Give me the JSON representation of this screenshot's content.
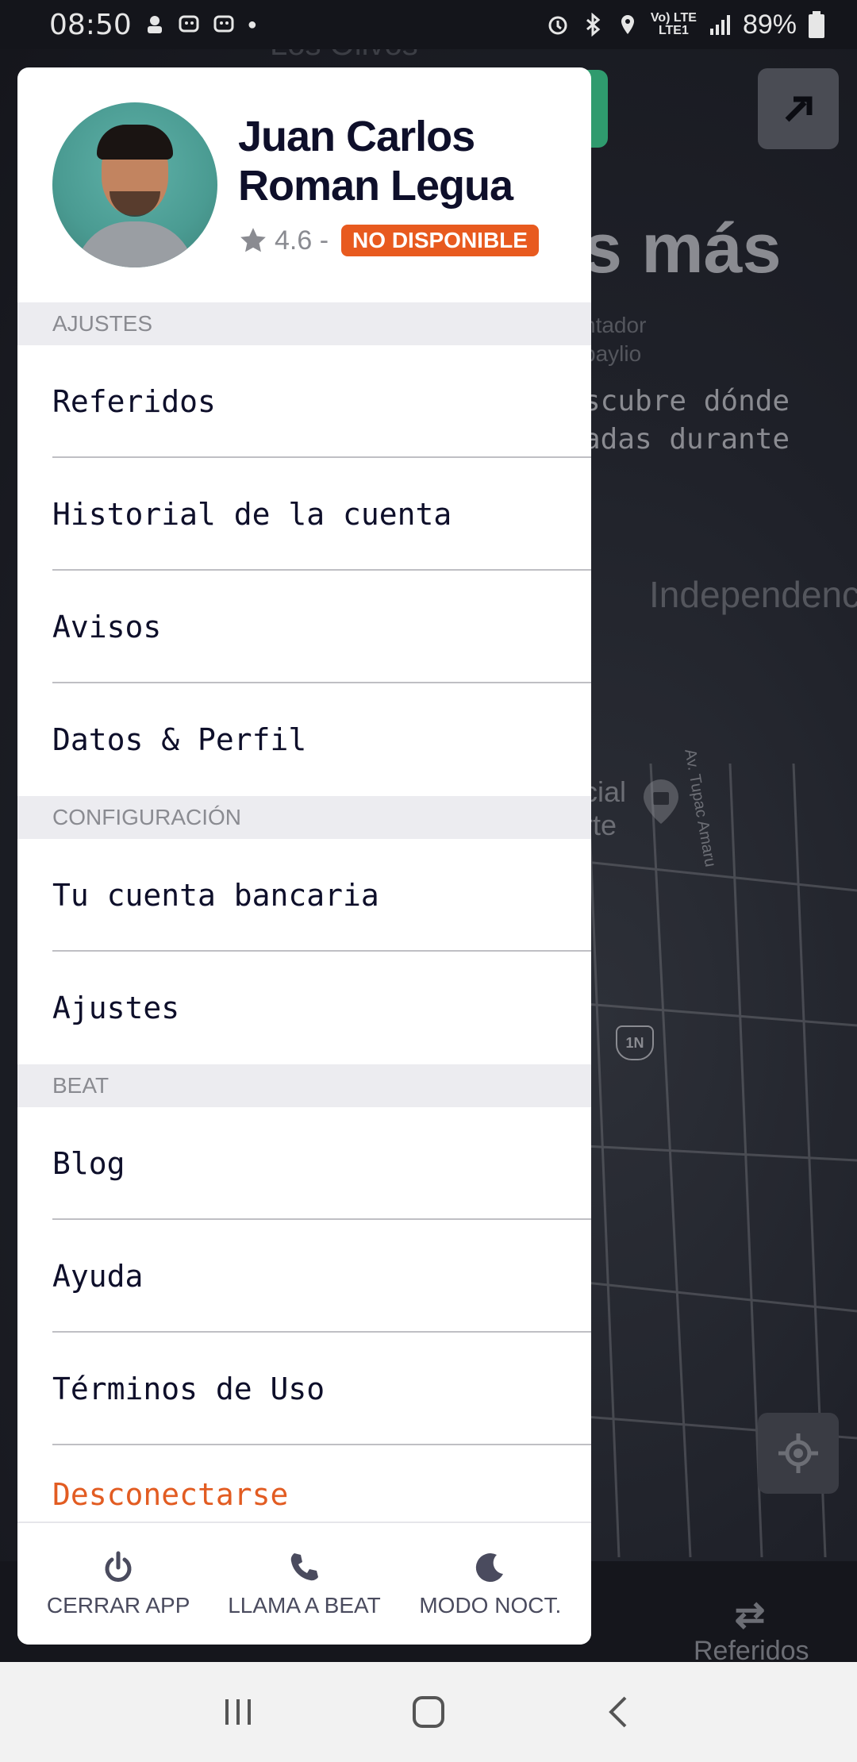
{
  "status_bar": {
    "time": "08:50",
    "network_label": "Vo) LTE\nLTE1",
    "battery": "89%"
  },
  "background": {
    "headline": "s más",
    "small_text": "ntador\nbaylio",
    "subtext": "scubre dónde\nadas durante",
    "place_independencia": "Independenc",
    "place_comercial": "cial\nrte",
    "road_label": "Av. Tupac Amaru",
    "highway": "1N",
    "top_place": "Los Olivos",
    "bottom_tab_label": "Referidos"
  },
  "profile": {
    "name_line1": "Juan Carlos",
    "name_line2": "Roman Legua",
    "rating": "4.6 -",
    "status_badge": "NO DISPONIBLE"
  },
  "sections": {
    "ajustes": "AJUSTES",
    "configuracion": "CONFIGURACIÓN",
    "beat": "BEAT"
  },
  "menu": {
    "referidos": "Referidos",
    "historial": "Historial de la cuenta",
    "avisos": "Avisos",
    "datos_perfil": "Datos & Perfil",
    "cuenta_bancaria": "Tu cuenta bancaria",
    "ajustes": "Ajustes",
    "blog": "Blog",
    "ayuda": "Ayuda",
    "terminos": "Términos de Uso",
    "desconectarse": "Desconectarse"
  },
  "drawer_actions": {
    "close_app": "CERRAR APP",
    "call_beat": "LLAMA A BEAT",
    "night_mode": "MODO NOCT."
  },
  "colors": {
    "accent_orange": "#e85a1f",
    "navy_text": "#0e0f2a",
    "section_bg": "#ececf0"
  }
}
